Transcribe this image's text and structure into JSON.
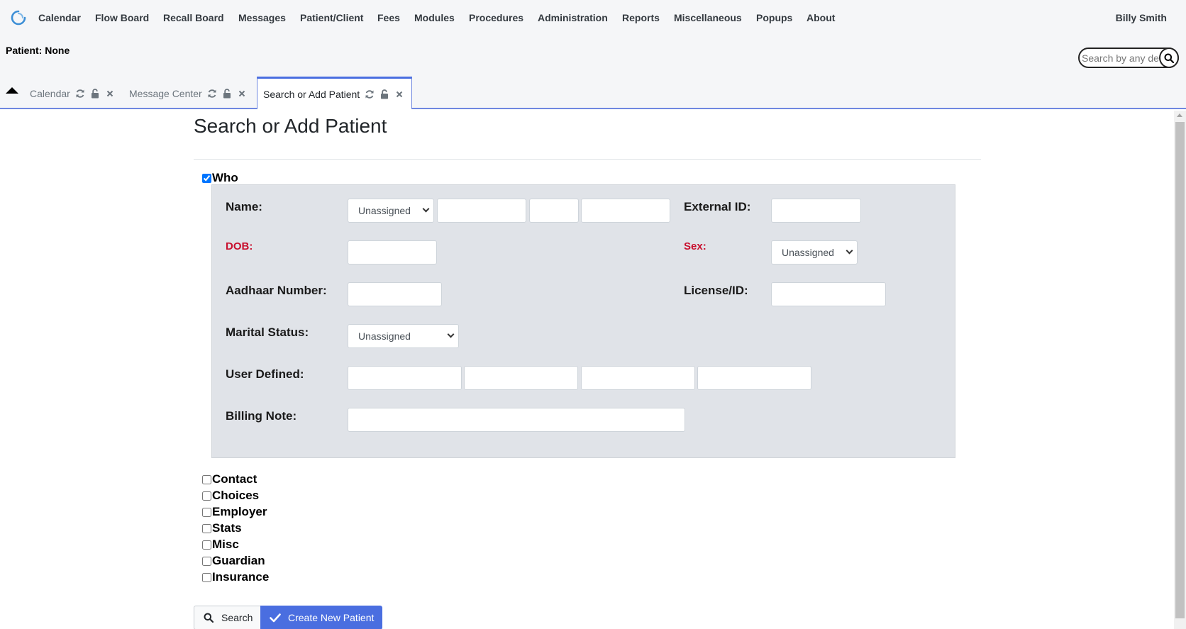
{
  "nav": {
    "items": [
      "Calendar",
      "Flow Board",
      "Recall Board",
      "Messages",
      "Patient/Client",
      "Fees",
      "Modules",
      "Procedures",
      "Administration",
      "Reports",
      "Miscellaneous",
      "Popups",
      "About"
    ],
    "user": "Billy Smith"
  },
  "patient_bar": {
    "label": "Patient: None",
    "search_placeholder": "Search by any demographics"
  },
  "tabs": [
    {
      "label": "Calendar",
      "active": false
    },
    {
      "label": "Message Center",
      "active": false
    },
    {
      "label": "Search or Add Patient",
      "active": true
    }
  ],
  "page": {
    "title": "Search or Add Patient"
  },
  "who": {
    "label": "Who",
    "checked": true,
    "name_label": "Name:",
    "title_select": "Unassigned",
    "external_id_label": "External ID:",
    "dob_label": "DOB:",
    "sex_label": "Sex:",
    "sex_select": "Unassigned",
    "aadhaar_label": "Aadhaar Number:",
    "license_label": "License/ID:",
    "marital_label": "Marital Status:",
    "marital_select": "Unassigned",
    "user_defined_label": "User Defined:",
    "billing_note_label": "Billing Note:"
  },
  "sections": [
    "Contact",
    "Choices",
    "Employer",
    "Stats",
    "Misc",
    "Guardian",
    "Insurance"
  ],
  "buttons": {
    "search": "Search",
    "create": "Create New Patient"
  },
  "colors": {
    "accent": "#4a6ee0",
    "required": "#c8102e",
    "panel": "#e0e3e8"
  }
}
